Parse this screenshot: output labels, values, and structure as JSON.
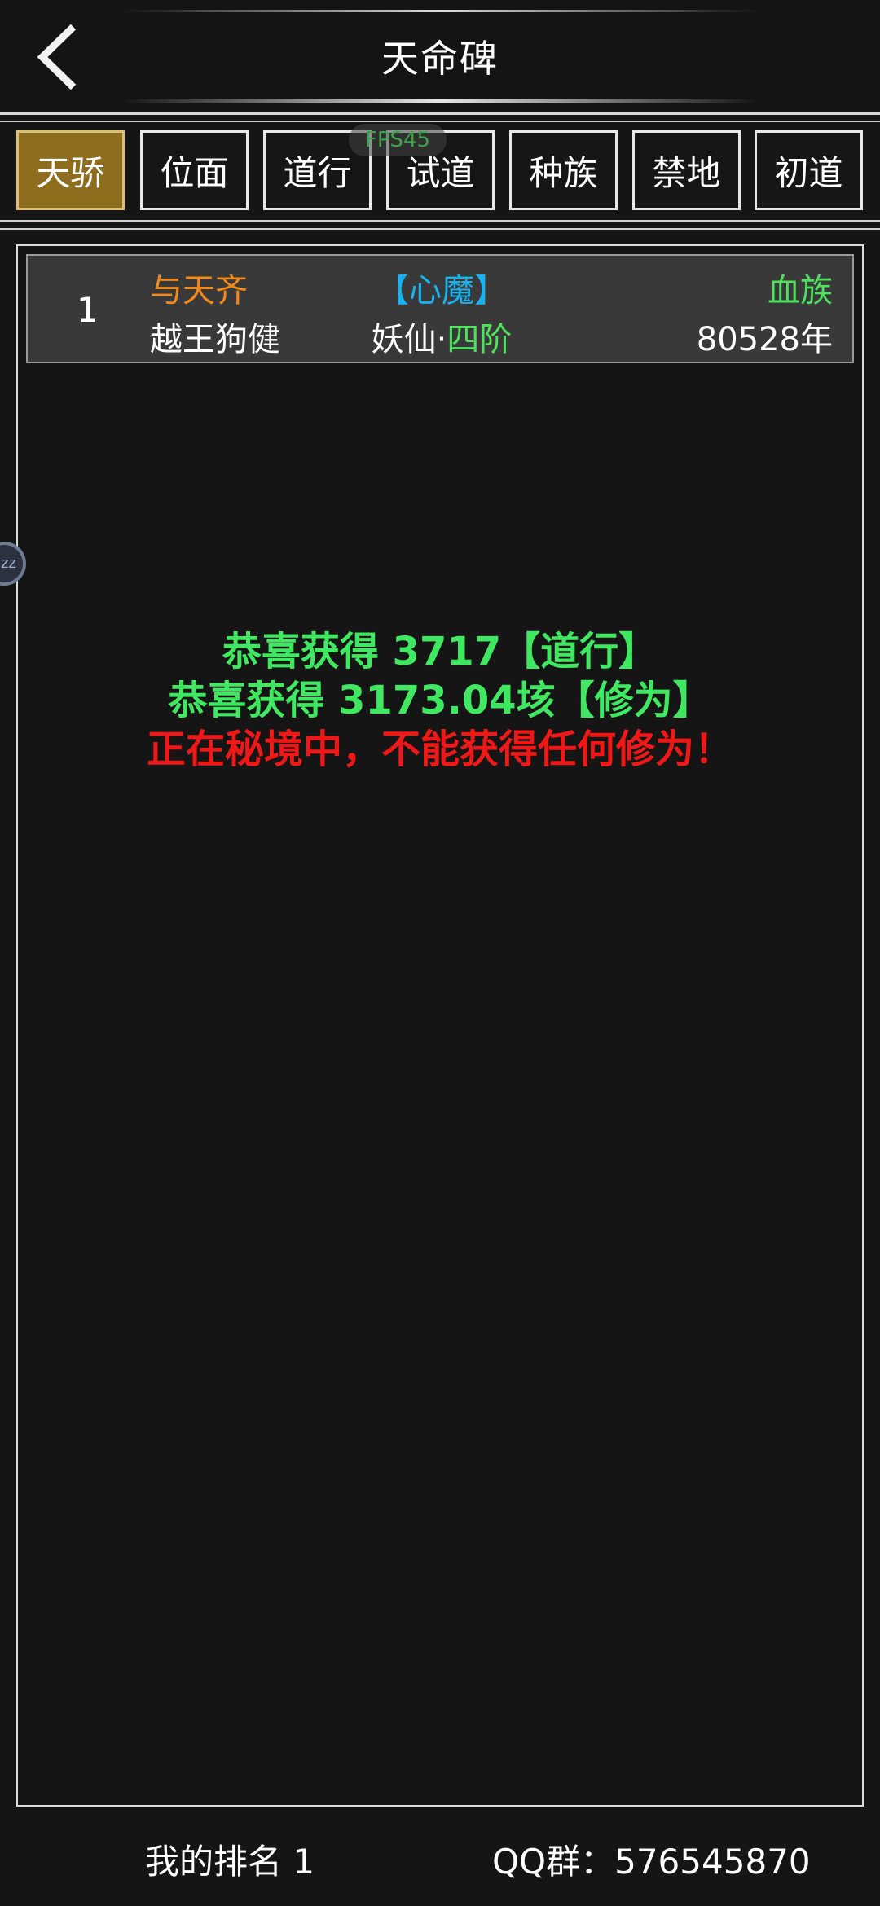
{
  "header": {
    "title": "天命碑",
    "back_icon": "chevron-left-icon"
  },
  "fps_overlay": "FPS45",
  "tabs": [
    {
      "label": "天骄",
      "active": true
    },
    {
      "label": "位面",
      "active": false
    },
    {
      "label": "道行",
      "active": false
    },
    {
      "label": "试道",
      "active": false
    },
    {
      "label": "种族",
      "active": false
    },
    {
      "label": "禁地",
      "active": false
    },
    {
      "label": "初道",
      "active": false
    }
  ],
  "rankings": [
    {
      "rank": "1",
      "title": "与天齐",
      "name": "越王狗健",
      "tag": "【心魔】",
      "realm": "妖仙",
      "realm_sep": "·",
      "stage": "四阶",
      "race": "血族",
      "age": "80528年"
    }
  ],
  "messages": {
    "line1": "恭喜获得 3717【道行】",
    "line2": "恭喜获得 3173.04垓【修为】",
    "line3": "正在秘境中，不能获得任何修为！"
  },
  "float_ball_text": "zz",
  "footer": {
    "my_rank": "我的排名 1",
    "qq_group": "QQ群：576545870"
  },
  "colors": {
    "active_tab": "#8e6d1e",
    "title_orange": "#f08a1c",
    "tag_blue": "#17b2f0",
    "green": "#4fe05e",
    "red": "#ee1818",
    "row_bg": "#393939",
    "page_bg": "#151515"
  }
}
